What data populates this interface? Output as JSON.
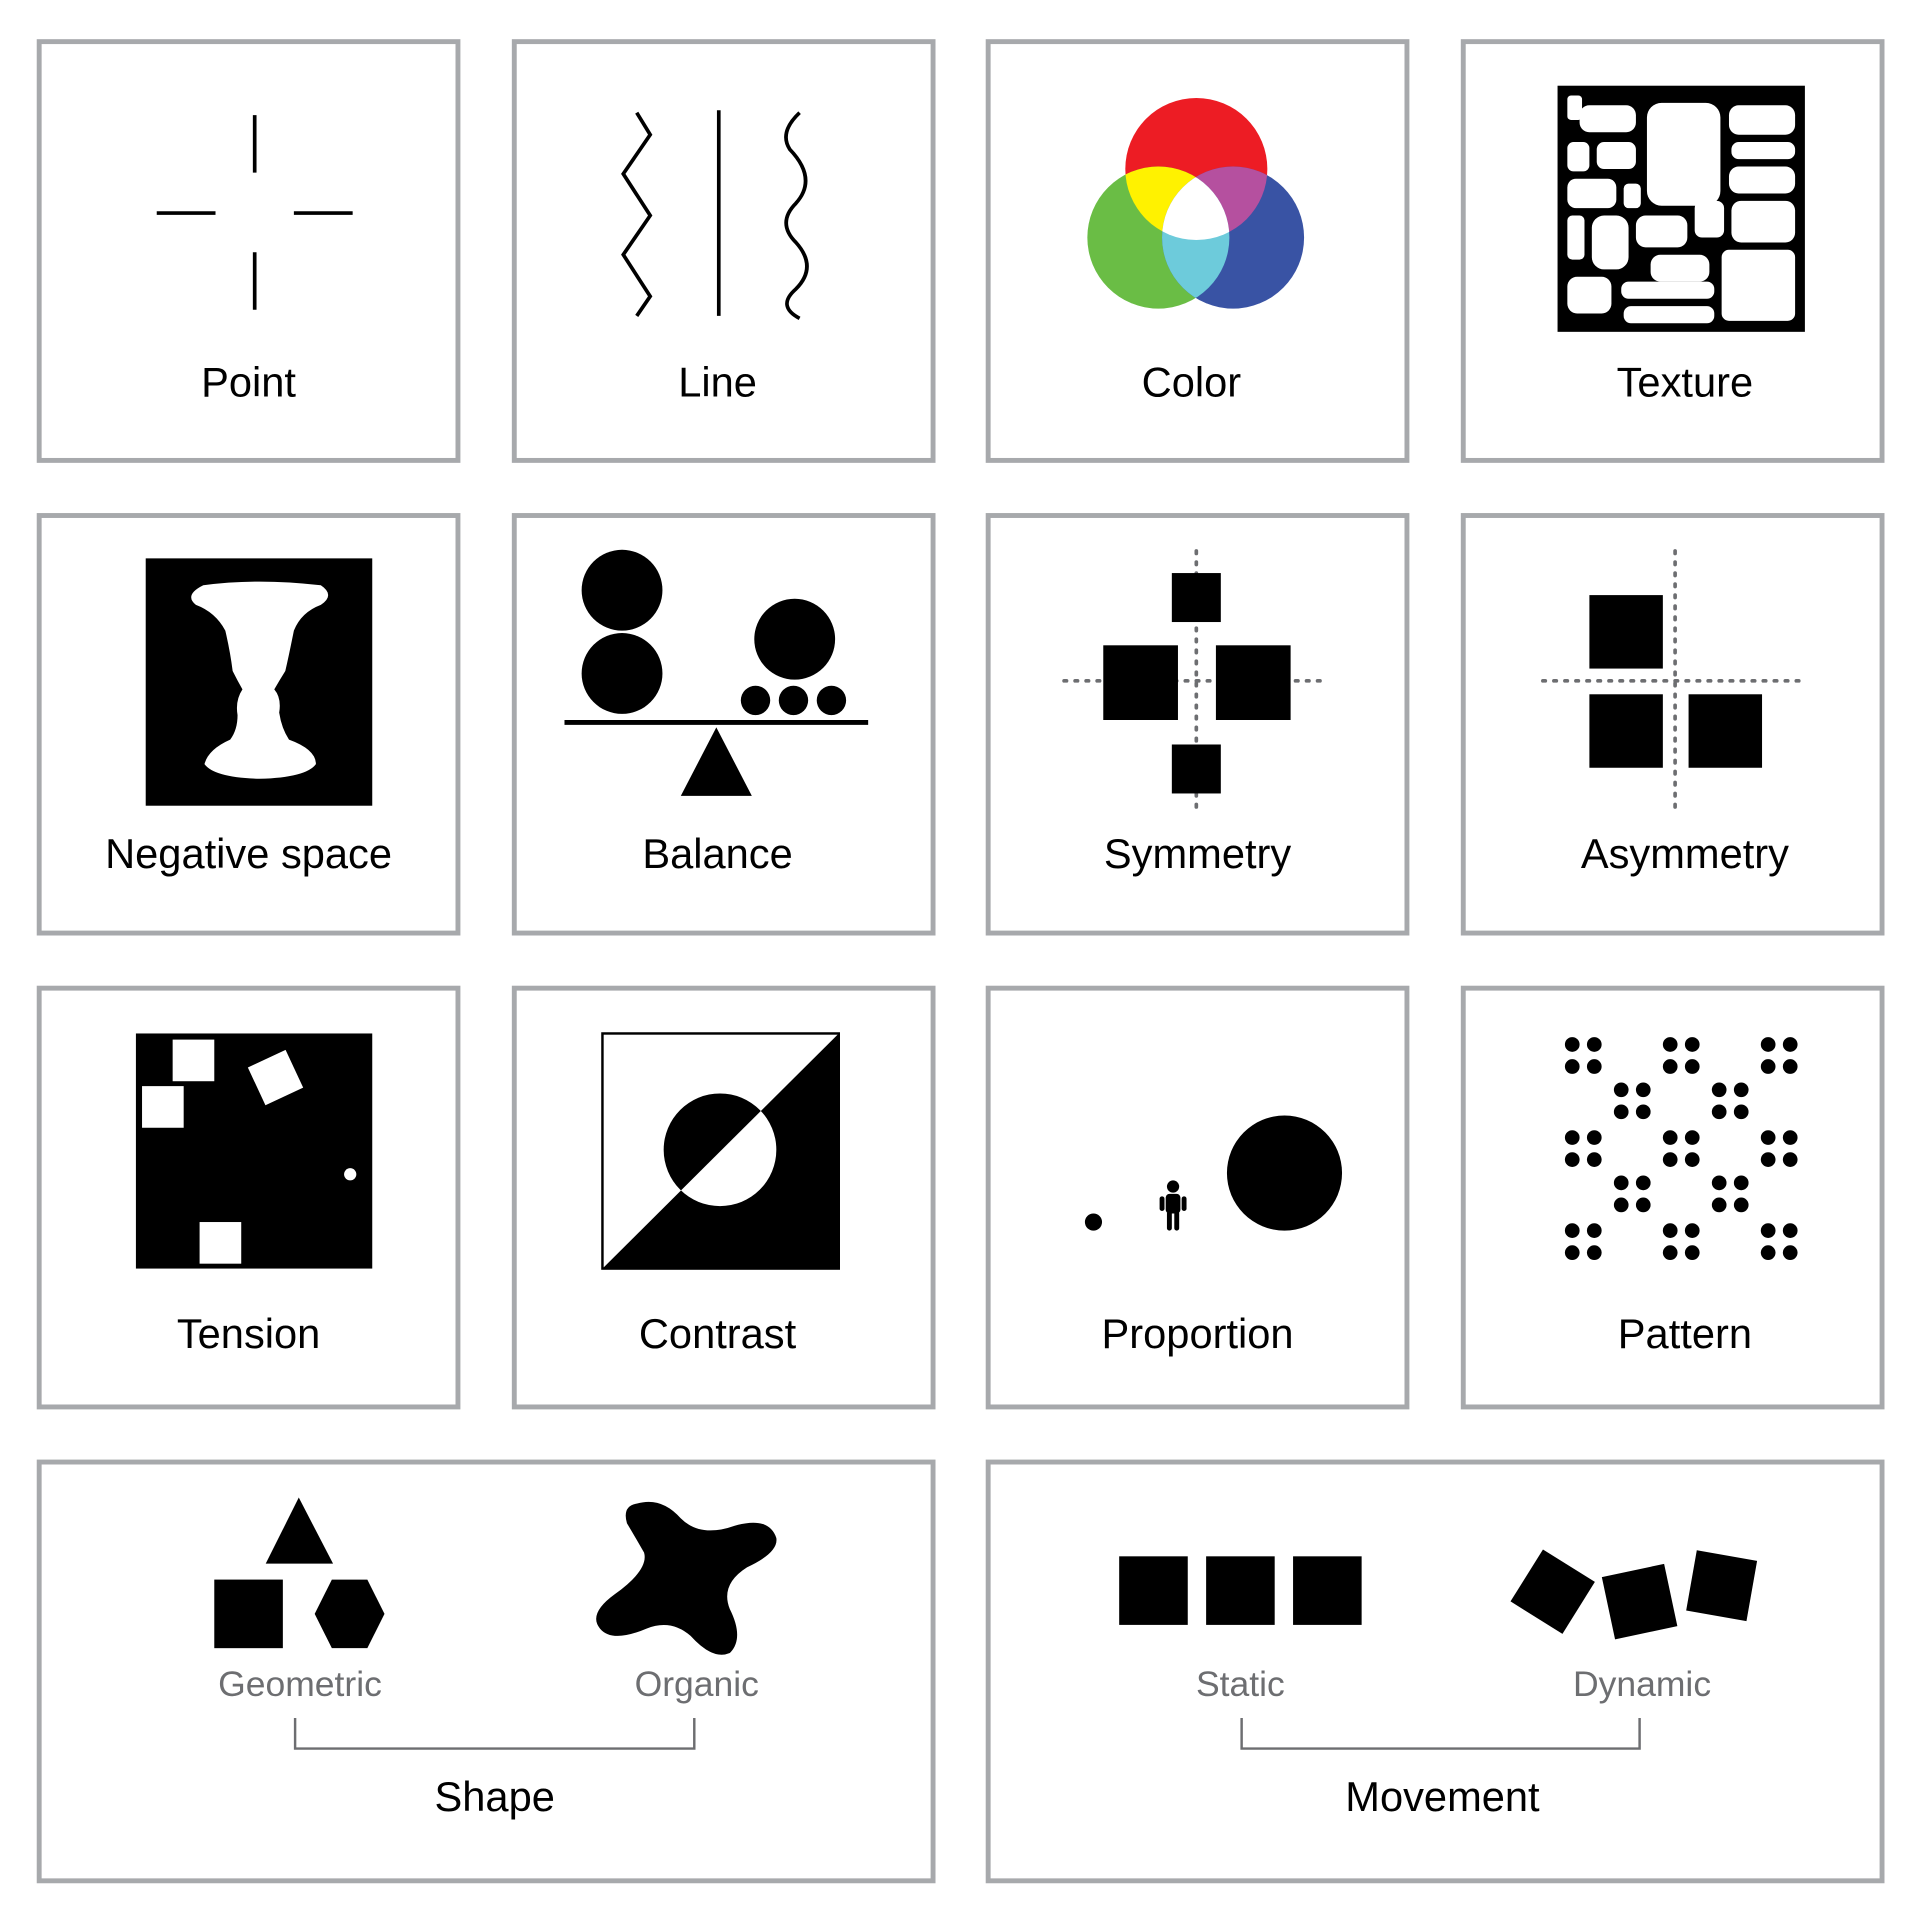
{
  "cards": {
    "point": "Point",
    "line": "Line",
    "color": "Color",
    "texture": "Texture",
    "negative_space": "Negative space",
    "balance": "Balance",
    "symmetry": "Symmetry",
    "asymmetry": "Asymmetry",
    "tension": "Tension",
    "contrast": "Contrast",
    "proportion": "Proportion",
    "pattern": "Pattern"
  },
  "shape": {
    "title": "Shape",
    "left": "Geometric",
    "right": "Organic"
  },
  "movement": {
    "title": "Movement",
    "left": "Static",
    "right": "Dynamic"
  },
  "colors": {
    "border": "#a7a9ac",
    "red": "#ed1c24",
    "green": "#6abd45",
    "blue": "#3953a4",
    "yellow": "#fff200",
    "magenta": "#b5509f",
    "cyan": "#6dcbdb",
    "sublabel": "#6d6e71"
  }
}
